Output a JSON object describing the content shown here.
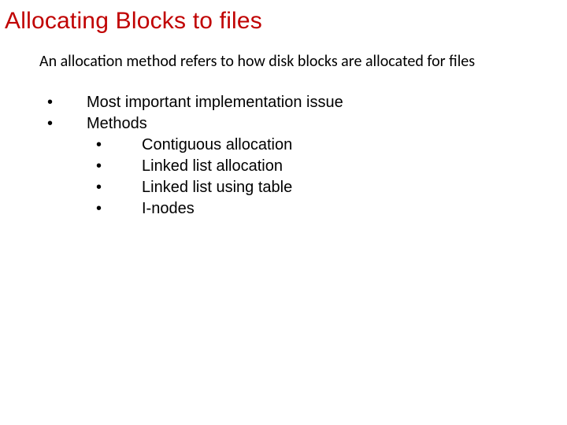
{
  "title": "Allocating Blocks to files",
  "intro": "An allocation method refers to how disk blocks are allocated for files",
  "bullets": {
    "level1": [
      "Most important implementation issue",
      "Methods"
    ],
    "level2": [
      "Contiguous allocation",
      "Linked list allocation",
      "Linked list using table",
      "I-nodes"
    ]
  }
}
